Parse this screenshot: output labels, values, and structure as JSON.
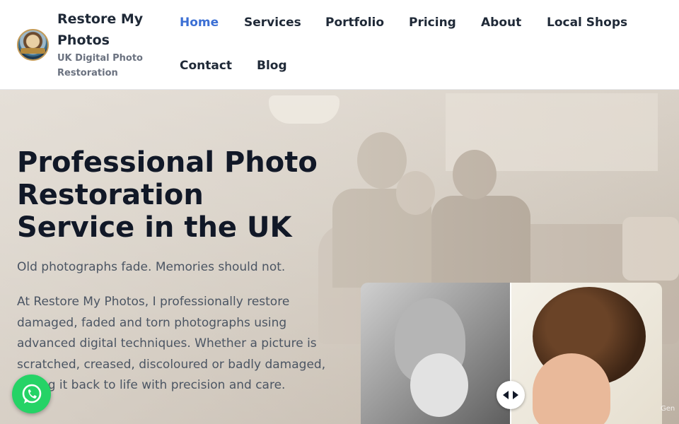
{
  "brand": {
    "title": "Restore My Photos",
    "subtitle": "UK Digital Photo Restoration",
    "logo_icon": "logo-badge-icon"
  },
  "nav": {
    "items": [
      {
        "label": "Home",
        "active": true
      },
      {
        "label": "Services",
        "active": false
      },
      {
        "label": "Portfolio",
        "active": false
      },
      {
        "label": "Pricing",
        "active": false
      },
      {
        "label": "About",
        "active": false
      },
      {
        "label": "Local Shops",
        "active": false
      },
      {
        "label": "Contact",
        "active": false
      },
      {
        "label": "Blog",
        "active": false
      }
    ]
  },
  "hero": {
    "title_line1": "Professional Photo",
    "title_line2": "Restoration",
    "title_line3": "Service in the UK",
    "tagline": "Old photographs fade. Memories should not.",
    "description": "At Restore My Photos, I professionally restore damaged, faded and torn photographs using advanced digital techniques. Whether a picture is scratched, creased, discoloured or badly damaged, I bring it back to life with precision and care.",
    "comparison": {
      "handle_icon": "drag-arrows-icon",
      "caption": "Gen"
    }
  },
  "floating": {
    "whatsapp_icon": "whatsapp-icon"
  },
  "colors": {
    "accent": "#3b6fd4",
    "heading": "#111827",
    "text": "#4b5563",
    "whatsapp": "#25d366"
  }
}
